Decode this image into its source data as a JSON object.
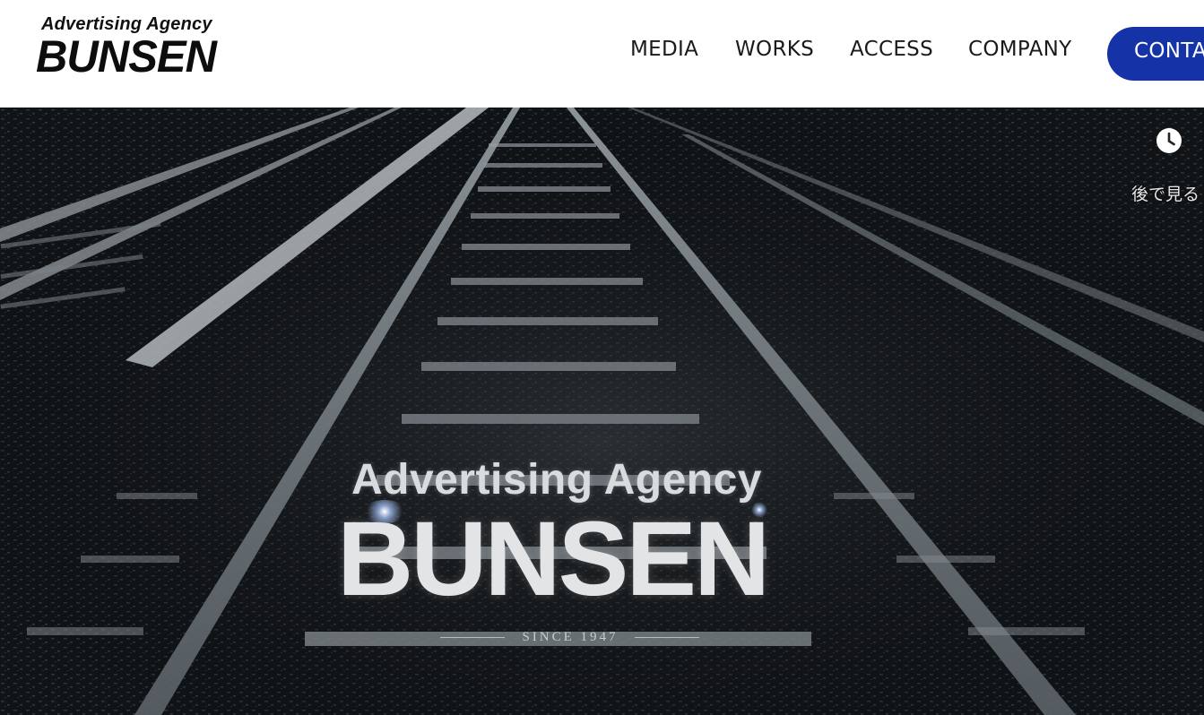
{
  "header": {
    "logo": {
      "tagline": "Advertising Agency",
      "brand": "BUNSEN"
    },
    "nav": [
      {
        "label": "MEDIA"
      },
      {
        "label": "WORKS"
      },
      {
        "label": "ACCESS"
      },
      {
        "label": "COMPANY"
      }
    ],
    "contact_label": "CONTA"
  },
  "hero": {
    "watch_later_label": "後で見る",
    "video_title": {
      "tagline": "Advertising Agency",
      "brand": "BUNSEN",
      "since": "SINCE   1947"
    }
  },
  "colors": {
    "accent": "#1533a6",
    "header_bg": "#ffffff",
    "nav_text": "#1a1a1a",
    "hero_bg": "#16191c"
  },
  "icons": {
    "watch_later": "clock-icon"
  }
}
